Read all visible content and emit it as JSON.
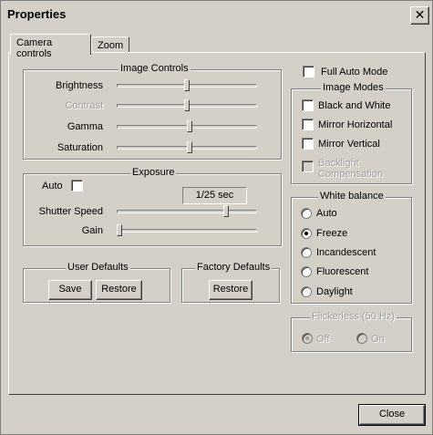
{
  "window": {
    "title": "Properties",
    "close_glyph": "✕"
  },
  "tabs": [
    {
      "label": "Camera controls",
      "active": true
    },
    {
      "label": "Zoom",
      "active": false
    }
  ],
  "image_controls": {
    "title": "Image Controls",
    "sliders": [
      {
        "label": "Brightness",
        "value": 0.5,
        "enabled": true
      },
      {
        "label": "Contrast",
        "value": 0.5,
        "enabled": false
      },
      {
        "label": "Gamma",
        "value": 0.52,
        "enabled": true
      },
      {
        "label": "Saturation",
        "value": 0.52,
        "enabled": true
      }
    ]
  },
  "exposure": {
    "title": "Exposure",
    "auto_label": "Auto",
    "auto_checked": false,
    "readout": "1/25 sec",
    "shutter_label": "Shutter Speed",
    "shutter_value": 0.79,
    "gain_label": "Gain",
    "gain_value": 0.0
  },
  "user_defaults": {
    "title": "User Defaults",
    "save": "Save",
    "restore": "Restore"
  },
  "factory_defaults": {
    "title": "Factory Defaults",
    "restore": "Restore"
  },
  "full_auto": {
    "label": "Full Auto Mode",
    "checked": false
  },
  "image_modes": {
    "title": "Image Modes",
    "items": [
      {
        "label": "Black and White",
        "checked": false,
        "enabled": true
      },
      {
        "label": "Mirror Horizontal",
        "checked": false,
        "enabled": true
      },
      {
        "label": "Mirror Vertical",
        "checked": false,
        "enabled": true
      },
      {
        "label": "Backlight",
        "label2": "Compensation",
        "checked": false,
        "enabled": false
      }
    ]
  },
  "white_balance": {
    "title": "White balance",
    "selected": "Freeze",
    "options": [
      "Auto",
      "Freeze",
      "Incandescent",
      "Fluorescent",
      "Daylight"
    ]
  },
  "flickerless": {
    "title": "Flickerless (50 Hz)",
    "selected": "Off",
    "options": [
      "Off",
      "On"
    ]
  },
  "footer": {
    "close": "Close"
  }
}
